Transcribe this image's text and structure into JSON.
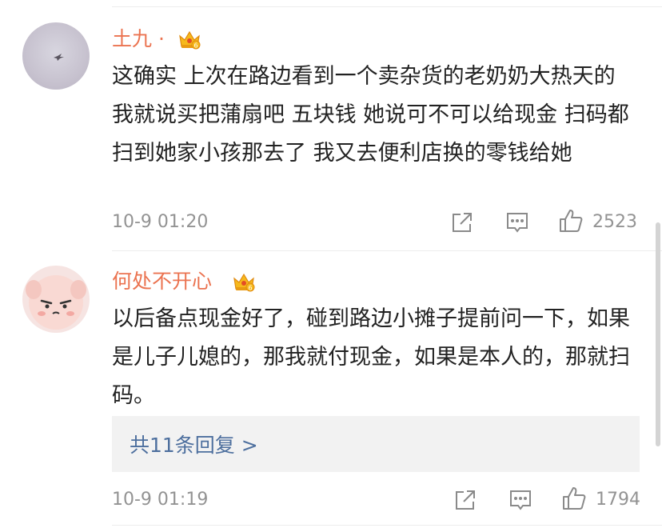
{
  "comments": [
    {
      "username": "土九 ·",
      "badge_icon": "vip-crown-icon",
      "avatar_icon": "bird-in-sky-avatar",
      "content": "这确实 上次在路边看到一个卖杂货的老奶奶大热天的 我就说买把蒲扇吧 五块钱 她说可不可以给现金 扫码都扫到她家小孩那去了 我又去便利店换的零钱给她",
      "time": "10-9 01:20",
      "likes": "2523"
    },
    {
      "username": "何处不开心",
      "badge_icon": "vip-crown-icon",
      "avatar_icon": "angry-pink-cat-avatar",
      "content": "以后备点现金好了，碰到路边小摊子提前问一下，如果是儿子儿媳的，那我就付现金，如果是本人的，那就扫码。",
      "replies_label": "共11条回复 >",
      "time": "10-9 01:19",
      "likes": "1794"
    }
  ],
  "colors": {
    "username": "#eb7350",
    "reply_link": "#4d6f9e",
    "meta_text": "#939393"
  }
}
